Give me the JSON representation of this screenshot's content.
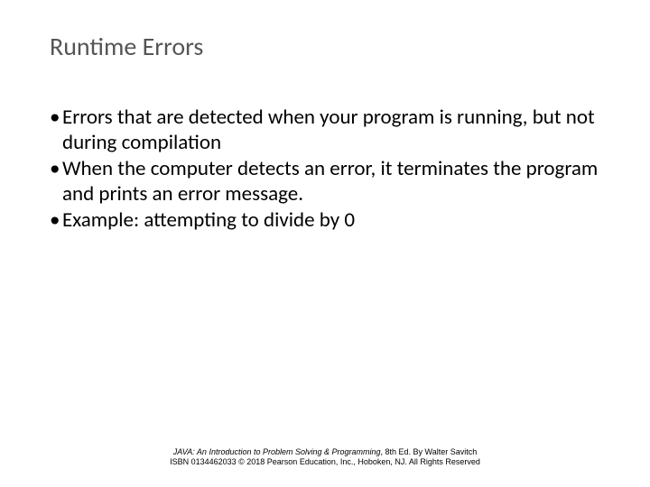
{
  "title": "Runtime Errors",
  "bullets": [
    "Errors that are detected when your program is running, but not during compilation",
    "When the computer detects an error, it terminates the program and prints an error message.",
    "Example: attempting to divide by 0"
  ],
  "footer": {
    "book_title": "JAVA: An Introduction to Problem Solving & Programming",
    "edition_author": ", 8th Ed. By Walter Savitch",
    "line2": "ISBN 0134462033 © 2018 Pearson Education, Inc., Hoboken, NJ. All Rights Reserved"
  }
}
